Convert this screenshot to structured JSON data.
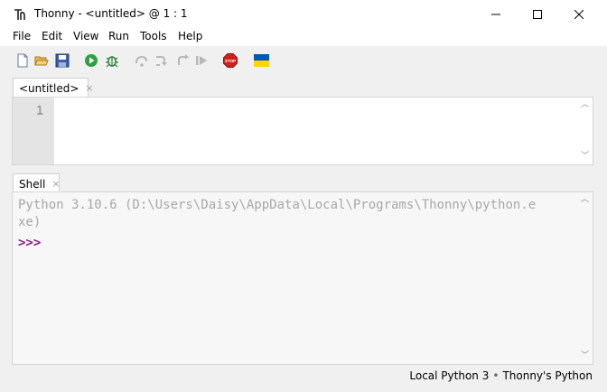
{
  "window": {
    "title": "Thonny  -  <untitled>  @  1 : 1",
    "minimize_label": "–",
    "maximize_label": "☐",
    "close_label": "✕"
  },
  "menu": [
    "File",
    "Edit",
    "View",
    "Run",
    "Tools",
    "Help"
  ],
  "toolbar": {
    "icons": [
      "new-file-icon",
      "open-file-icon",
      "save-icon",
      "run-icon",
      "debug-icon",
      "step-over-icon",
      "step-into-icon",
      "step-out-icon",
      "resume-icon",
      "stop-icon",
      "ukraine-flag-icon"
    ],
    "stop_label": "STOP"
  },
  "editor": {
    "tab_label": "<untitled>",
    "tab_close": "×",
    "line_number": "1"
  },
  "shell": {
    "tab_label": "Shell",
    "tab_close": "×",
    "output_line1": "Python 3.10.6 (D:\\Users\\Daisy\\AppData\\Local\\Programs\\Thonny\\python.e",
    "output_line2": "xe)",
    "prompt": ">>>"
  },
  "status": {
    "interpreter": "Local Python 3",
    "separator": "•",
    "backend": "Thonny's Python"
  },
  "colors": {
    "prompt": "#8b1a8b",
    "run_green": "#2ea043",
    "stop_red": "#d0201c",
    "flag_blue": "#0057b7",
    "flag_yellow": "#ffd700"
  }
}
